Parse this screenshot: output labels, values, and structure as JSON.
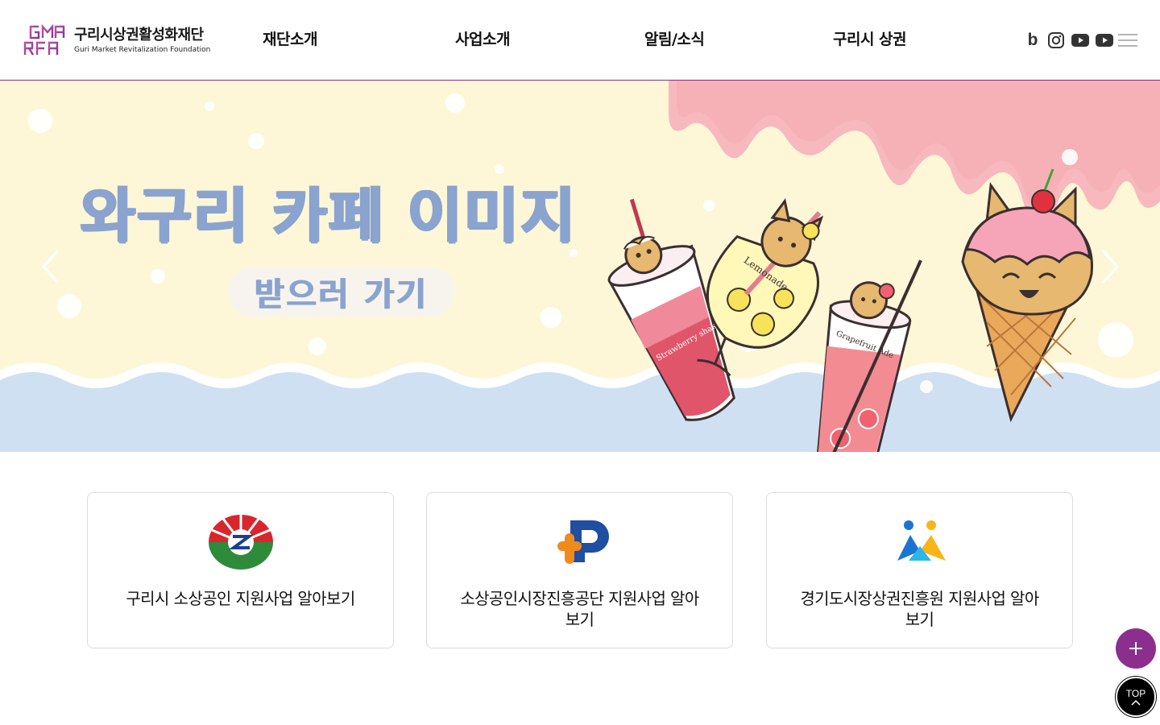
{
  "header": {
    "logo_ko": "구리시상권활성화재단",
    "logo_en": "Guri Market Revitalization Foundation",
    "nav": [
      "재단소개",
      "사업소개",
      "알림/소식",
      "구리시 상권"
    ],
    "social": [
      "blog-icon",
      "instagram-icon",
      "youtube-icon",
      "youtube-icon"
    ]
  },
  "hero": {
    "title": "와구리 카페 이미지",
    "cta": "받으러 가기",
    "cup_labels": {
      "strawberry": "Strawberry shake",
      "lemonade": "Lemonade",
      "grapefruit": "Grapefruit Ade"
    }
  },
  "cards": [
    {
      "icon": "guri-seal-icon",
      "label": "구리시 소상공인 지원사업 알아보기"
    },
    {
      "icon": "semas-p-logo-icon",
      "label": "소상공인시장진흥공단 지원사업 알아보기"
    },
    {
      "icon": "gyeonggi-market-logo-icon",
      "label": "경기도시장상권진흥원 지원사업 알아보기"
    }
  ],
  "floating": {
    "top_label": "TOP"
  },
  "colors": {
    "brand_purple": "#8b2e8e",
    "hero_text": "#8aa3cf",
    "hero_cream": "#fdf7d8",
    "hero_blue": "#cfe0f3",
    "drip_pink": "#f7b9bd"
  }
}
